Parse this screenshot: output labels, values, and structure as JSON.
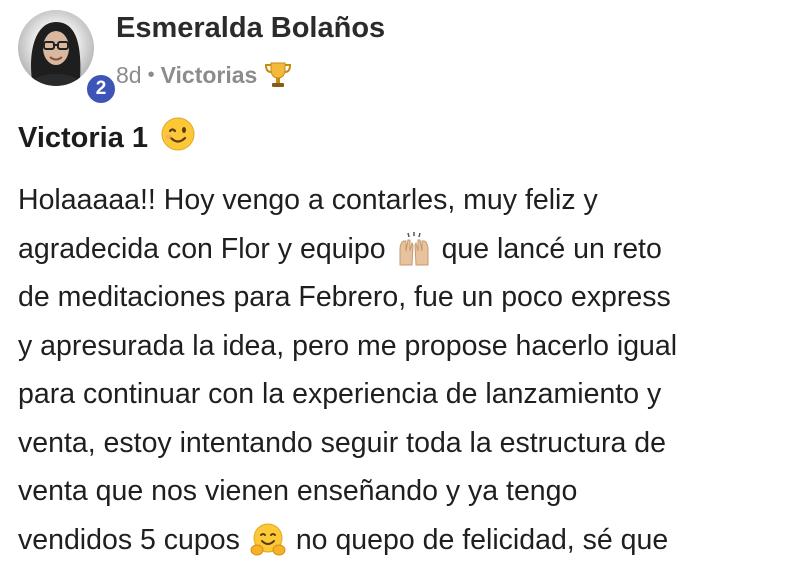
{
  "author": {
    "name": "Esmeralda Bolaños",
    "level": "2"
  },
  "meta": {
    "time_ago": "8d",
    "separator": "•",
    "category": "Victorias",
    "category_icon": "trophy-icon"
  },
  "post": {
    "title": "Victoria 1",
    "title_emoji": "winking-face-icon",
    "lines": [
      {
        "before": "Holaaaaa!! Hoy vengo a contarles, muy feliz y",
        "emoji": null,
        "after": ""
      },
      {
        "before": "agradecida con Flor y equipo",
        "emoji": "raising-hands-icon",
        "after": "que lancé un reto"
      },
      {
        "before": "de meditaciones para Febrero, fue un poco express",
        "emoji": null,
        "after": ""
      },
      {
        "before": "y apresurada la idea, pero me propose hacerlo igual",
        "emoji": null,
        "after": ""
      },
      {
        "before": "para continuar con la experiencia de lanzamiento y",
        "emoji": null,
        "after": ""
      },
      {
        "before": "venta, estoy intentando seguir toda la estructura de",
        "emoji": null,
        "after": ""
      },
      {
        "before": "venta que nos vienen enseñando y ya tengo",
        "emoji": null,
        "after": ""
      },
      {
        "before": "vendidos 5 cupos",
        "emoji": "hugging-face-icon",
        "after": "no quepo de felicidad, sé que"
      }
    ]
  }
}
